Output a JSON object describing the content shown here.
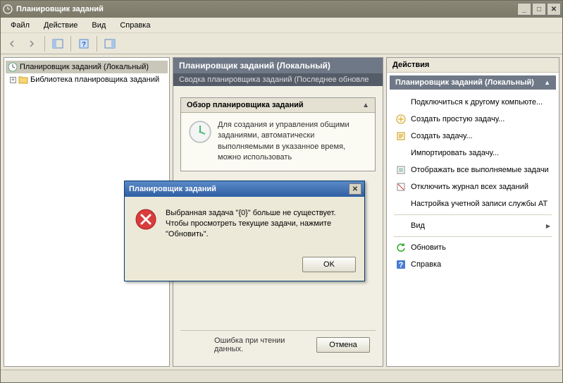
{
  "window": {
    "title": "Планировщик заданий"
  },
  "menu": {
    "file": "Файл",
    "action": "Действие",
    "view": "Вид",
    "help": "Справка"
  },
  "tree": {
    "root": "Планировщик заданий (Локальный)",
    "library": "Библиотека планировщика заданий"
  },
  "center": {
    "header": "Планировщик заданий (Локальный)",
    "subheader": "Сводка планировщика заданий (Последнее обновле",
    "overview_title": "Обзор планировщика заданий",
    "overview_text": "Для создания и управления общими заданиями, автоматически выполняемыми в указанное время, можно использовать",
    "footer_error": "Ошибка при чтении данных.",
    "cancel": "Отмена"
  },
  "actions": {
    "title": "Действия",
    "header": "Планировщик заданий (Локальный)",
    "items": {
      "connect": "Подключиться к другому компьюте...",
      "create_basic": "Создать простую задачу...",
      "create_task": "Создать задачу...",
      "import": "Импортировать задачу...",
      "show_running": "Отображать все выполняемые задачи",
      "disable_history": "Отключить журнал всех заданий",
      "at_account": "Настройка учетной записи службы AT",
      "view": "Вид",
      "refresh": "Обновить",
      "help": "Справка"
    }
  },
  "dialog": {
    "title": "Планировщик заданий",
    "message": "Выбранная задача \"{0}\" больше не существует. Чтобы просмотреть текущие задачи, нажмите \"Обновить\".",
    "ok": "OK"
  }
}
